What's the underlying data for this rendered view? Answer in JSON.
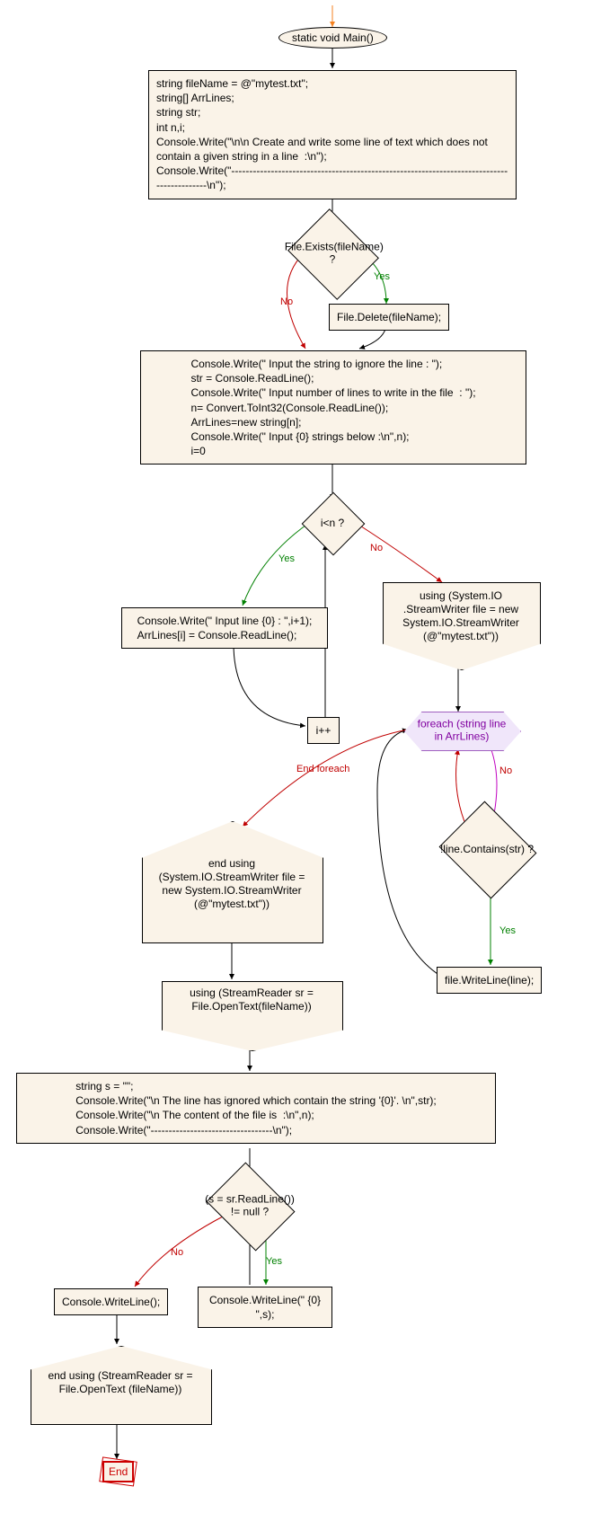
{
  "terminator_main": "static void Main()",
  "proc_init": "string fileName = @\"mytest.txt\";\nstring[] ArrLines;\nstring str;\nint n,i;\nConsole.Write(\"\\n\\n Create and write some line of text which does not contain a given string in a line  :\\n\");\nConsole.Write(\"-------------------------------------------------------------------------------------------\\n\");",
  "dec_fileexists": "File.Exists(fileName) ?",
  "proc_filedelete": "File.Delete(fileName);",
  "proc_inputs": "Console.Write(\" Input the string to ignore the line : \");\nstr = Console.ReadLine();\nConsole.Write(\" Input number of lines to write in the file  : \");\nn= Convert.ToInt32(Console.ReadLine());\nArrLines=new string[n];\nConsole.Write(\" Input {0} strings below :\\n\",n);\ni=0",
  "dec_iltn": "i<n ?",
  "proc_readline": "Console.Write(\" Input line {0} : \",i+1);\nArrLines[i] = Console.ReadLine();",
  "proc_incr": "i++",
  "using_writer": "using (System.IO .StreamWriter file = new System.IO.StreamWriter (@\"mytest.txt\"))",
  "foreach_lines": "foreach (string line in ArrLines)",
  "dec_contains": "!line.Contains(str) ?",
  "proc_writeline": "file.WriteLine(line);",
  "endusing_writer": "end using (System.IO.StreamWriter file = new System.IO.StreamWriter (@\"mytest.txt\"))",
  "using_reader": "using (StreamReader sr = File.OpenText(fileName))",
  "proc_header": "string s = \"\";\nConsole.Write(\"\\n The line has ignored which contain the string '{0}'. \\n\",str);\nConsole.Write(\"\\n The content of the file is  :\\n\",n);\nConsole.Write(\"----------------------------------\\n\");",
  "dec_readloop": "(s = sr.ReadLine()) != null ?",
  "proc_writes": "Console.WriteLine(\" {0} \",s);",
  "proc_writeblank": "Console.WriteLine();",
  "endusing_reader": "end using (StreamReader sr = File.OpenText (fileName))",
  "end_label": "End",
  "labels": {
    "yes": "Yes",
    "no": "No",
    "endforeach": "End foreach"
  }
}
